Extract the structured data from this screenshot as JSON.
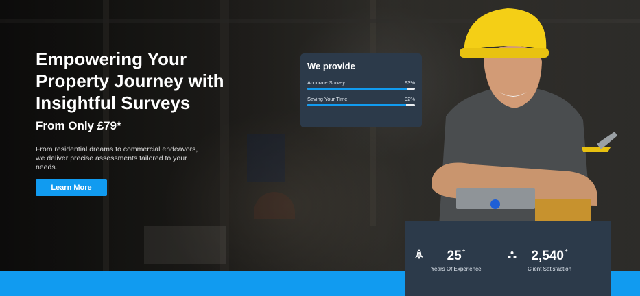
{
  "hero": {
    "headline": "Empowering Your Property Journey with Insightful Surveys",
    "price": "From Only £79*",
    "description": "From residential dreams to commercial endeavors, we deliver precise assessments tailored to your needs.",
    "cta_label": "Learn More"
  },
  "provide": {
    "title": "We provide",
    "skills": [
      {
        "label": "Accurate Survey",
        "percent_text": "93%",
        "value": 93
      },
      {
        "label": "Saving Your Time",
        "percent_text": "92%",
        "value": 92
      }
    ]
  },
  "stats": [
    {
      "icon": "rocket-icon",
      "number": "25",
      "suffix": "+",
      "label": "Years Of Experience"
    },
    {
      "icon": "users-icon",
      "number": "2,540",
      "suffix": "+",
      "label": "Client Satisfaction"
    }
  ],
  "colors": {
    "accent": "#119bf0",
    "panel": "#2c3a4a"
  }
}
